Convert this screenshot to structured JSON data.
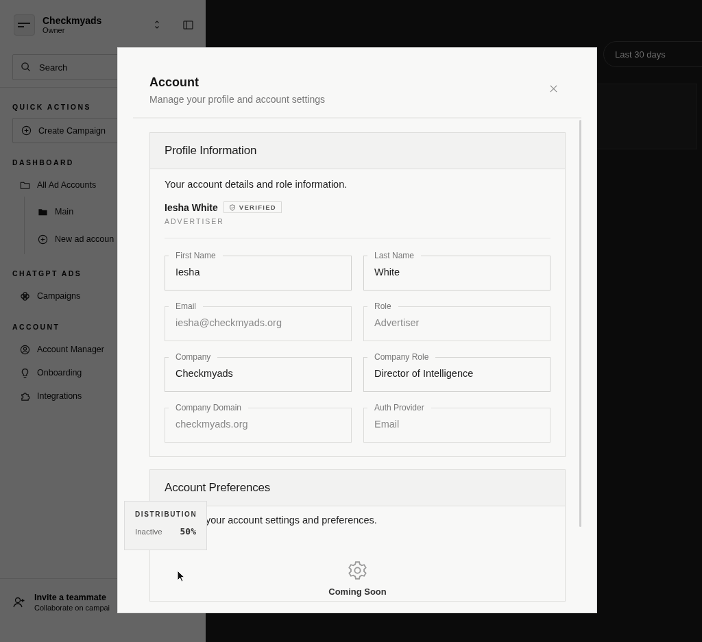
{
  "sidebar": {
    "workspace": {
      "name": "Checkmyads",
      "role": "Owner"
    },
    "search": {
      "placeholder": "Search"
    },
    "sections": [
      {
        "title": "QUICK ACTIONS",
        "items": [
          {
            "label": "Create Campaign",
            "kind": "action"
          }
        ]
      },
      {
        "title": "DASHBOARD",
        "items": [
          {
            "label": "All Ad Accounts",
            "kind": "item",
            "children": [
              {
                "label": "Main",
                "kind": "item"
              },
              {
                "label": "New ad accoun",
                "kind": "item"
              }
            ]
          }
        ]
      },
      {
        "title": "CHATGPT ADS",
        "items": [
          {
            "label": "Campaigns",
            "kind": "item"
          }
        ]
      },
      {
        "title": "ACCOUNT",
        "items": [
          {
            "label": "Account Manager",
            "kind": "item"
          },
          {
            "label": "Onboarding",
            "kind": "item"
          },
          {
            "label": "Integrations",
            "kind": "item"
          }
        ]
      }
    ],
    "invite": {
      "title": "Invite a teammate",
      "subtitle": "Collaborate on campai"
    }
  },
  "toolbar": {
    "date_range": "Last 30 days"
  },
  "dialog": {
    "title": "Account",
    "subtitle": "Manage your profile and account settings",
    "profile": {
      "title": "Profile Information",
      "description": "Your account details and role information.",
      "name": "Iesha White",
      "badge": "VERIFIED",
      "role": "ADVERTISER",
      "fields": [
        {
          "label": "First Name",
          "value": "Iesha",
          "disabled": false
        },
        {
          "label": "Last Name",
          "value": "White",
          "disabled": false
        },
        {
          "label": "Email",
          "value": "iesha@checkmyads.org",
          "disabled": true
        },
        {
          "label": "Role",
          "value": "Advertiser",
          "disabled": true
        },
        {
          "label": "Company",
          "value": "Checkmyads",
          "disabled": false
        },
        {
          "label": "Company Role",
          "value": "Director of Intelligence",
          "disabled": false
        },
        {
          "label": "Company Domain",
          "value": "checkmyads.org",
          "disabled": true
        },
        {
          "label": "Auth Provider",
          "value": "Email",
          "disabled": true
        }
      ]
    },
    "preferences": {
      "title": "Account Preferences",
      "description": "your account settings and preferences.",
      "status": "Coming Soon"
    }
  },
  "tooltip": {
    "title": "DISTRIBUTION",
    "label": "Inactive",
    "value": "50%"
  }
}
